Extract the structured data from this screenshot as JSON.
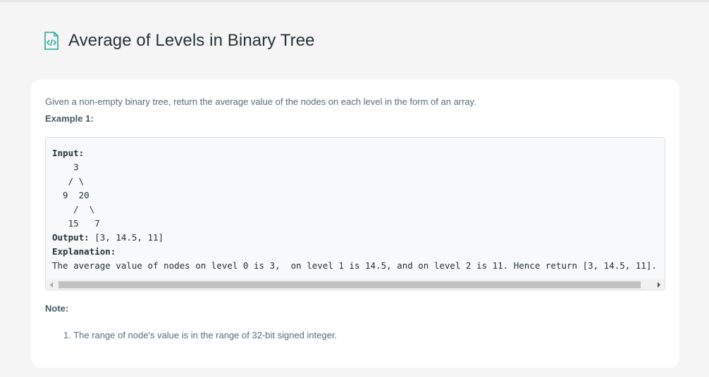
{
  "page": {
    "title": "Average of Levels in Binary Tree",
    "title_icon": "code-document-icon",
    "accent_color": "#26a69a"
  },
  "problem": {
    "description": "Given a non-empty binary tree, return the average value of the nodes on each level in the form of an array.",
    "example_label": "Example 1:",
    "example": {
      "input_label": "Input:",
      "tree_lines": [
        "    3",
        "   / \\",
        "  9  20",
        "    /  \\",
        "   15   7"
      ],
      "output_label": "Output:",
      "output_value": " [3, 14.5, 11]",
      "explanation_label": "Explanation:",
      "explanation_text": "The average value of nodes on level 0 is 3,  on level 1 is 14.5, and on level 2 is 11. Hence return [3, 14.5, 11]."
    },
    "note_label": "Note:",
    "notes": [
      "1. The range of node's value is in the range of 32-bit signed integer."
    ]
  }
}
